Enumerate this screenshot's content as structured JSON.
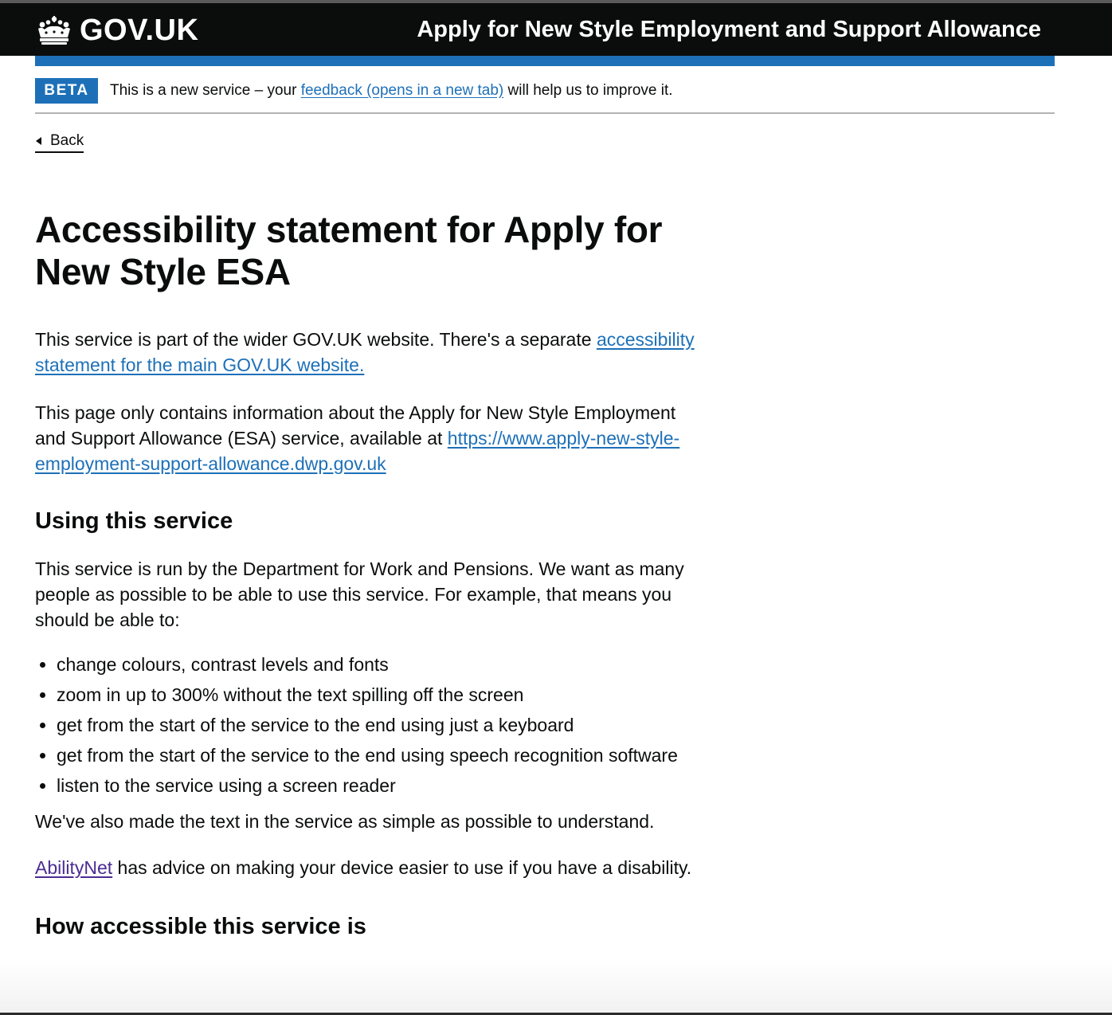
{
  "header": {
    "logo_text": "GOV.UK",
    "logo_icon": "crown-icon",
    "service_name": "Apply for New Style Employment and Support Allowance"
  },
  "phase_banner": {
    "tag": "BETA",
    "text_before": "This is a new service – your ",
    "link_text": "feedback (opens in a new tab)",
    "text_after": " will help us to improve it."
  },
  "back_link": {
    "label": "Back",
    "icon": "triangle-left-icon"
  },
  "content": {
    "title": "Accessibility statement for Apply for New Style ESA",
    "intro": {
      "text": "This service is part of the wider GOV.UK website. There's a separate ",
      "link": "accessibility statement for the main GOV.UK website."
    },
    "scope": {
      "text": "This page only contains information about the Apply for New Style Employment and Support Allowance (ESA) service, available at ",
      "link": "https://www.apply-new-style-employment-support-allowance.dwp.gov.uk"
    },
    "using_heading": "Using this service",
    "using_text": "This service is run by the Department for Work and Pensions. We want as many people as possible to be able to use this service. For example, that means you should be able to:",
    "list": [
      "change colours, contrast levels and fonts",
      "zoom in up to 300% without the text spilling off the screen",
      "get from the start of the service to the end using just a keyboard",
      "get from the start of the service to the end using speech recognition software",
      "listen to the service using a screen reader"
    ],
    "simple_text": "We've also made the text in the service as simple as possible to understand.",
    "abilitynet": {
      "link": "AbilityNet",
      "text": " has advice on making your device easier to use if you have a disability."
    },
    "how_heading": "How accessible this service is"
  },
  "colors": {
    "header_bg": "#0b0c0c",
    "brand_blue": "#1d70b8",
    "link": "#1d70b8",
    "visited_link": "#4c2c92",
    "text": "#0b0c0c"
  }
}
